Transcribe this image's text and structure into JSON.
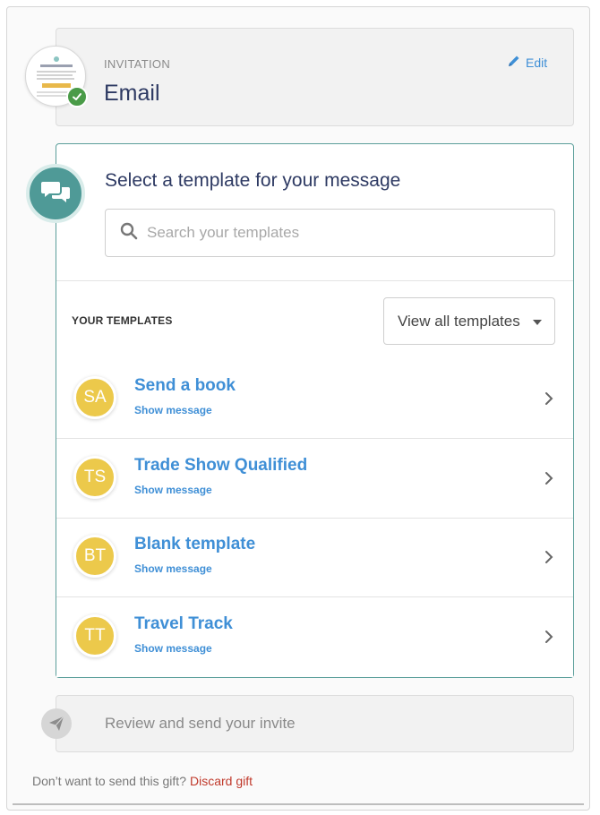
{
  "invitation": {
    "label": "INVITATION",
    "title": "Email",
    "edit_label": "Edit"
  },
  "template_section": {
    "heading": "Select a template for your message",
    "search": {
      "placeholder": "Search your templates",
      "value": ""
    },
    "your_templates_label": "YOUR TEMPLATES",
    "view_all_label": "View all templates",
    "templates": [
      {
        "initials": "SA",
        "name": "Send a book",
        "action": "Show message"
      },
      {
        "initials": "TS",
        "name": "Trade Show Qualified",
        "action": "Show message"
      },
      {
        "initials": "BT",
        "name": "Blank template",
        "action": "Show message"
      },
      {
        "initials": "TT",
        "name": "Travel Track",
        "action": "Show message"
      }
    ]
  },
  "review": {
    "text": "Review and send your invite"
  },
  "footer": {
    "question": "Don’t want to send this gift?",
    "discard_label": "Discard gift"
  },
  "icons": {
    "edit": "pencil-icon",
    "check": "check-icon",
    "chat": "chat-bubbles-icon",
    "search": "search-icon",
    "caret": "caret-down-icon",
    "row": "chevron-right-icon",
    "send": "paper-plane-icon"
  },
  "colors": {
    "accent_blue": "#3f8fd6",
    "teal": "#4f9a97",
    "avatar_yellow": "#ecc94b",
    "success_green": "#4a9b48",
    "discard_red": "#c0392b",
    "heading_navy": "#2e3a63"
  }
}
